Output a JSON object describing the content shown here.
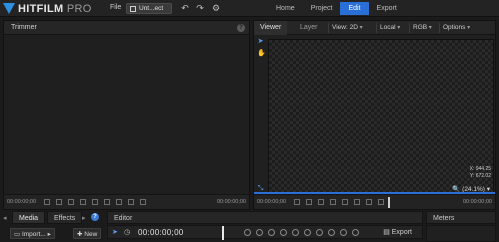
{
  "app": {
    "logo_brand": "HITFILM",
    "logo_suffix": "PRO",
    "menu_file": "File",
    "project_name": "Unt...ect"
  },
  "main_tabs": [
    {
      "label": "Home"
    },
    {
      "label": "Project"
    },
    {
      "label": "Edit",
      "active": true
    },
    {
      "label": "Export"
    }
  ],
  "trimmer": {
    "title": "Trimmer",
    "timecode_left": "00:00:00;00",
    "timecode_right": "00:00:00;00"
  },
  "viewer": {
    "tabs": [
      {
        "label": "Viewer",
        "active": true
      },
      {
        "label": "Layer"
      }
    ],
    "view_mode": "View: 2D",
    "space": "Local",
    "channel": "RGB",
    "options": "Options",
    "coord_x": "X:   944.25",
    "coord_y": "Y:   672.02",
    "zoom": "(24.1%)",
    "timecode_left": "00:00:00;00",
    "timecode_right": "00:00:00;00"
  },
  "bottom": {
    "tab_media": "Media",
    "tab_effects": "Effects",
    "import_label": "Import...",
    "new_label": "New",
    "editor_title": "Editor",
    "editor_timecode": "00:00:00;00",
    "export_label": "Export",
    "meters_title": "Meters"
  },
  "colors": {
    "accent": "#2a6fd6",
    "background": "#1b1b1b",
    "panel": "#202020"
  }
}
